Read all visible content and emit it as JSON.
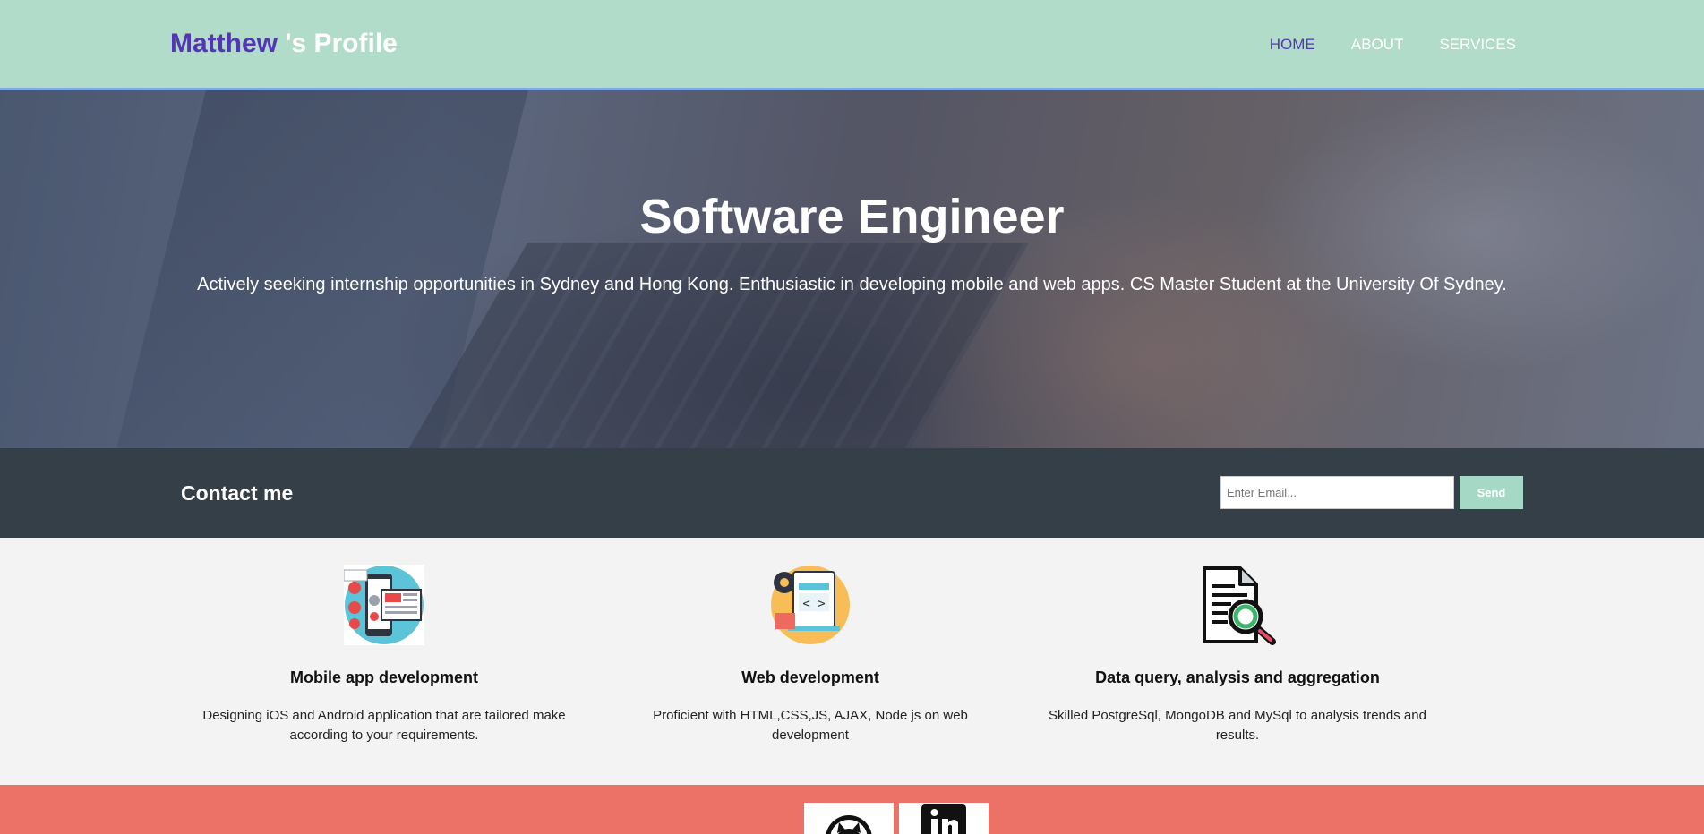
{
  "header": {
    "logo_name": "Matthew",
    "logo_rest": " 's Profile",
    "nav": [
      {
        "label": "HOME",
        "active": true
      },
      {
        "label": "ABOUT",
        "active": false
      },
      {
        "label": "SERVICES",
        "active": false
      }
    ]
  },
  "hero": {
    "title": "Software Engineer",
    "subtitle": "Actively seeking internship opportunities in Sydney and Hong Kong. Enthusiastic in developing mobile and web apps. CS Master Student at the University Of Sydney."
  },
  "contact": {
    "title": "Contact me",
    "email_placeholder": "Enter Email...",
    "send_label": "Send"
  },
  "services": [
    {
      "icon": "mobile-app-icon",
      "title": "Mobile app development",
      "description": "Designing iOS and Android application that are tailored make according to your requirements."
    },
    {
      "icon": "web-development-icon",
      "title": "Web development",
      "description": "Proficient with HTML,CSS,JS, AJAX, Node js on web development"
    },
    {
      "icon": "data-analysis-icon",
      "title": "Data query, analysis and aggregation",
      "description": "Skilled PostgreSql, MongoDB and MySql to analysis trends and results."
    }
  ],
  "footer": {
    "social": [
      "github-icon",
      "linkedin-icon"
    ]
  },
  "colors": {
    "header_bg": "#b0dcc9",
    "accent_purple": "#5535b5",
    "contact_bg": "#343f47",
    "send_button": "#a5d9c6",
    "footer_bg": "#ec7267"
  }
}
